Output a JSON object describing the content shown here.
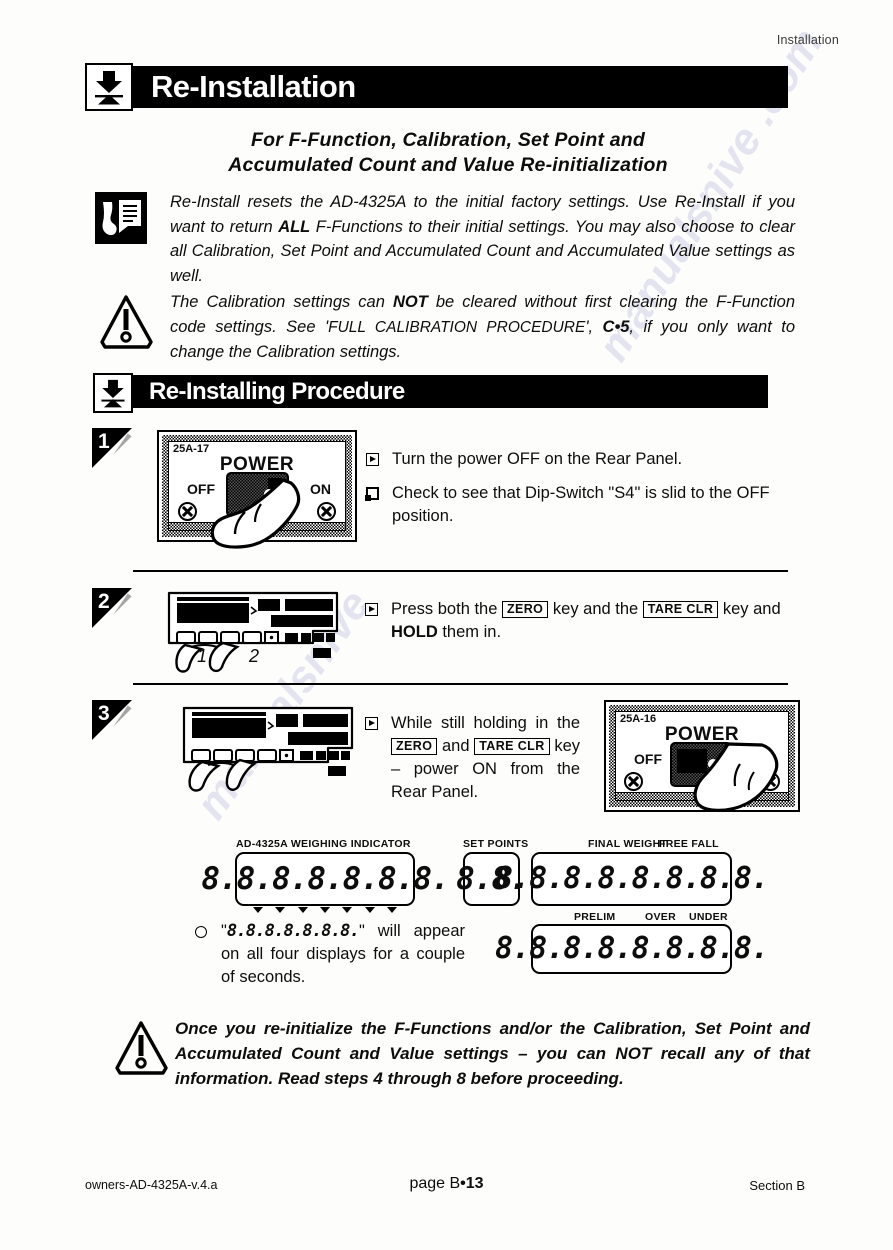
{
  "runhead": "Installation",
  "banner1": {
    "title": "Re-Installation",
    "icon": "install-down-arrow-icon"
  },
  "subtitle_line1": "For F-Function, Calibration, Set Point and",
  "subtitle_line2": "Accumulated Count and Value Re-initialization",
  "note1": {
    "icon": "speaker-note-icon",
    "text_a": "Re-Install resets the AD-4325A to the initial factory settings.  Use Re-Install if you want to return ",
    "bold_b": "ALL",
    "text_c": " F-Functions to their initial settings. You may also choose to clear all Calibration, Set Point and Accumulated Count and Accumulated Value settings as well."
  },
  "warn1": {
    "icon": "warning-triangle-icon",
    "text_a": "The Calibration settings can ",
    "bold_b": "NOT",
    "text_c": " be cleared without first clearing the F-Function code settings.  See '",
    "smallcaps_d": "FULL CALIBRATION PROCEDURE",
    "text_e": "', ",
    "bold_f": "C•5",
    "text_g": ", if you only want to change the Calibration settings."
  },
  "banner2": {
    "title": "Re-Installing  Procedure",
    "icon": "install-down-arrow-icon"
  },
  "steps": [
    {
      "number": "1",
      "panel": {
        "code": "25A-17",
        "title": "POWER",
        "off": "OFF",
        "on": "ON",
        "state": "off"
      },
      "bullets": [
        {
          "glyph": "play",
          "text": "Turn the power OFF on the Rear Panel."
        },
        {
          "glyph": "box",
          "text": "Check to see that Dip-Switch \"S4\" is slid to the OFF position."
        }
      ]
    },
    {
      "number": "2",
      "finger_labels": [
        "1",
        "2"
      ],
      "bullet_glyph": "play",
      "text_a": "Press both the ",
      "key1": "ZERO",
      "text_b": " key and the ",
      "key2": "TARE CLR",
      "text_c": " key and ",
      "bold_d": "HOLD",
      "text_e": " them in."
    },
    {
      "number": "3",
      "bullet_glyph": "play",
      "text_a": "While  still  holding  in  the ",
      "key1": "ZERO",
      "text_b": " and ",
      "key2": "TARE CLR",
      "text_c": " key – power ON from the Rear Panel.",
      "panel": {
        "code": "25A-16",
        "title": "POWER",
        "off": "OFF",
        "on": "ON",
        "state": "on"
      }
    }
  ],
  "displays": {
    "main_label": "AD-4325A WEIGHING INDICATOR",
    "main_digits": "8.8.8.8.8.8.8.",
    "setpoints_label": "SET POINTS",
    "setpoints_digits": "8.8.",
    "finalweight_label": "FINAL WEIGHT",
    "freefall_label": "FREE FALL",
    "upper_right_digits": "8.8.8.8.8.8.8.8.",
    "prelim_label": "PRELIM",
    "over_label": "OVER",
    "under_label": "UNDER",
    "lower_right_digits": "8.8.8.8.8.8.8.8."
  },
  "display_note": {
    "glyph": "circle",
    "quote_open": "\"",
    "digits": "8.8.8.8.8.8.8.",
    "quote_close": "\"",
    "text": " will appear on all four displays for a couple of seconds."
  },
  "warn2": {
    "icon": "warning-triangle-icon",
    "text": "Once you re-initialize the F-Functions and/or the Calibration, Set Point and Accumulated Count and Value settings – you can NOT recall any of that information. Read steps 4 through 8 before proceeding."
  },
  "footer": {
    "left": "owners-AD-4325A-v.4.a",
    "center_a": "page B",
    "center_b": "•13",
    "right": "Section B"
  },
  "watermarks": [
    "manualsnive .com",
    "manualsnive"
  ]
}
